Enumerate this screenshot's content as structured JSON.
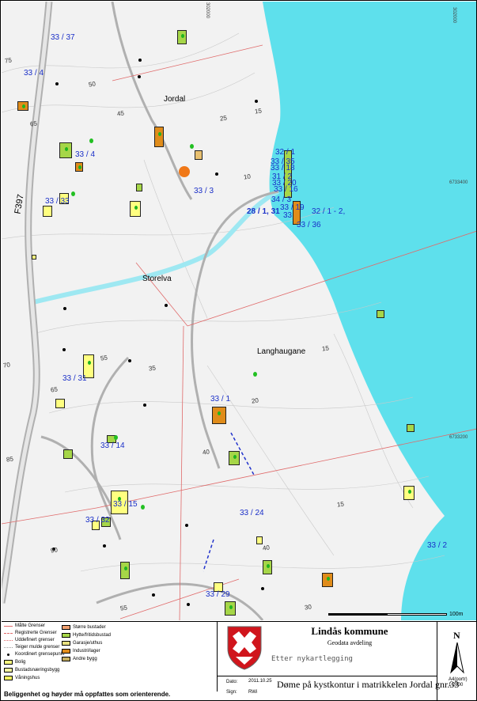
{
  "map": {
    "parcel_labels": [
      "33 / 37",
      "33 / 4",
      "33 / 4",
      "33 / 33",
      "33 / 3",
      "28 / 1, 31",
      "32 / 1 - 2,",
      "32 / 1",
      "33 / 35",
      "33 / 18",
      "31 / 2",
      "33 / 20",
      "33 / 16",
      "34 / 3",
      "33 / 19",
      "33",
      "33 / 36",
      "33 / 31",
      "33 / 1",
      "33 / 14",
      "33 / 15",
      "33 / 32",
      "33 / 24",
      "33 / 2",
      "33 / 29"
    ],
    "place_names": [
      "Jordal",
      "Storelva",
      "Langhaugane"
    ],
    "road_name": "F397",
    "contour_labels": [
      "75",
      "50",
      "45",
      "65",
      "25",
      "15",
      "10",
      "55",
      "35",
      "65",
      "70",
      "20",
      "15",
      "40",
      "15",
      "85",
      "40",
      "30",
      "55",
      "90"
    ],
    "coordinate_labels": [
      "6733400",
      "6733200",
      "302000",
      "302000"
    ],
    "scale_end_label": "100m",
    "colors": {
      "sea": "#5ee0ec",
      "river": "#9ee8f2",
      "road": "#b0b0b0",
      "property_line": "#e06a6a",
      "building_residential": "#ffff80",
      "building_cabin": "#a6d648",
      "building_industry": "#e08c1a",
      "building_farm": "#e8c070",
      "label_blue": "#1a2fc8"
    }
  },
  "legend": {
    "left": [
      "Målte Grenser",
      "Registrerte Grenser",
      "Uddefinert grenser",
      "Teiger mulde grenser",
      "Koordinert grensepunkt",
      "Bolig",
      "Bustadsnæringsbygg",
      "Våningshus"
    ],
    "right": [
      "Større bustader",
      "Hytte/fritidsbustad",
      "Garasje/uthus",
      "Industri/lager",
      "Andre bygg"
    ],
    "disclaimer": "Beliggenhet og høyder må oppfattes som orienterende."
  },
  "title_block": {
    "municipality": "Lindås kommune",
    "department": "Geodata avdeling",
    "subtitle": "Etter nykartlegging",
    "title": "Døme på kystkontur i matrikkelen Jordal gnr.33",
    "date_label": "Dato:",
    "date_value": "2011.10.25",
    "sign_label": "Sign:",
    "sign_value": "RWi",
    "north_letter": "N",
    "scale_lines": [
      "A4(portr)",
      "1:2000"
    ]
  }
}
